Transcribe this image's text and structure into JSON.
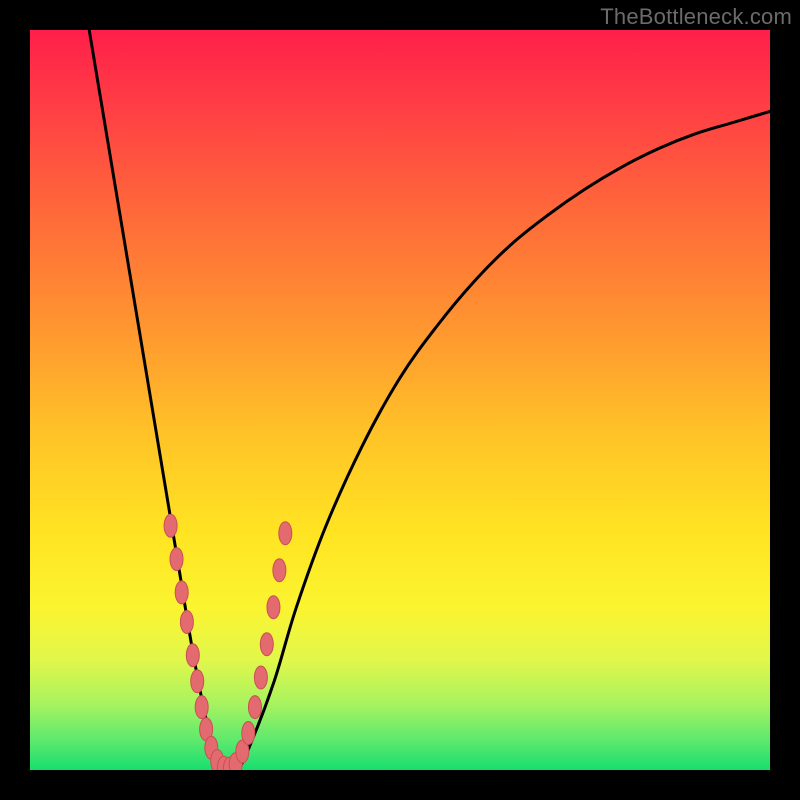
{
  "watermark": "TheBottleneck.com",
  "colors": {
    "frame_bg": "#000000",
    "curve_stroke": "#000000",
    "marker_fill": "#E36A6E",
    "marker_stroke": "#C94F55",
    "gradient_stops": [
      "#FF1F4A",
      "#FF3D45",
      "#FF6A3A",
      "#FF9530",
      "#FFC427",
      "#FFE422",
      "#FBF430",
      "#E2F74A",
      "#A8F35F",
      "#5DE96E",
      "#17DE6F"
    ]
  },
  "chart_data": {
    "type": "line",
    "title": "",
    "xlabel": "",
    "ylabel": "",
    "xlim": [
      0,
      100
    ],
    "ylim": [
      0,
      100
    ],
    "series": [
      {
        "name": "bottleneck-curve",
        "x": [
          8,
          10,
          12,
          14,
          16,
          18,
          20,
          22,
          24,
          26,
          28,
          30,
          33,
          36,
          40,
          45,
          50,
          55,
          60,
          65,
          70,
          75,
          80,
          85,
          90,
          95,
          100
        ],
        "values": [
          100,
          88,
          76,
          64,
          52,
          40,
          28,
          16,
          6,
          0,
          0,
          4,
          12,
          22,
          33,
          44,
          53,
          60,
          66,
          71,
          75,
          78.5,
          81.5,
          84,
          86,
          87.5,
          89
        ]
      }
    ],
    "markers": {
      "name": "highlighted-points",
      "x": [
        19.0,
        19.8,
        20.5,
        21.2,
        22.0,
        22.6,
        23.2,
        23.8,
        24.5,
        25.3,
        26.2,
        27.0,
        27.8,
        28.7,
        29.5,
        30.4,
        31.2,
        32.0,
        32.9,
        33.7,
        34.5
      ],
      "values": [
        33.0,
        28.5,
        24.0,
        20.0,
        15.5,
        12.0,
        8.5,
        5.5,
        3.0,
        1.2,
        0.3,
        0.2,
        0.8,
        2.5,
        5.0,
        8.5,
        12.5,
        17.0,
        22.0,
        27.0,
        32.0
      ]
    }
  }
}
